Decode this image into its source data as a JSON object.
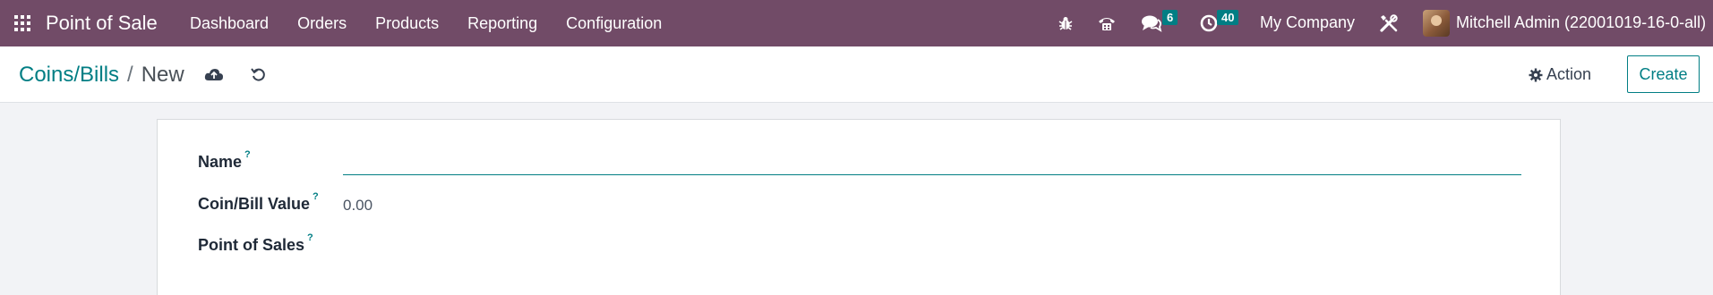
{
  "navbar": {
    "brand": "Point of Sale",
    "menu": [
      "Dashboard",
      "Orders",
      "Products",
      "Reporting",
      "Configuration"
    ],
    "messages_count": "6",
    "activities_count": "40",
    "company": "My Company",
    "user": "Mitchell Admin (22001019-16-0-all)",
    "icons": [
      "apps-icon",
      "bug-icon",
      "phone-icon",
      "chat-icon",
      "clock-icon",
      "tools-icon"
    ]
  },
  "control_panel": {
    "breadcrumb_parent": "Coins/Bills",
    "breadcrumb_separator": "/",
    "breadcrumb_current": "New",
    "action_label": "Action",
    "create_label": "Create"
  },
  "form": {
    "name_label": "Name",
    "name_value": "",
    "value_label": "Coin/Bill Value",
    "value_value": "0.00",
    "pos_label": "Point of Sales",
    "help_mark": "?"
  },
  "colors": {
    "navbar": "#714b67",
    "accent": "#017e84",
    "background": "#f2f3f6"
  }
}
